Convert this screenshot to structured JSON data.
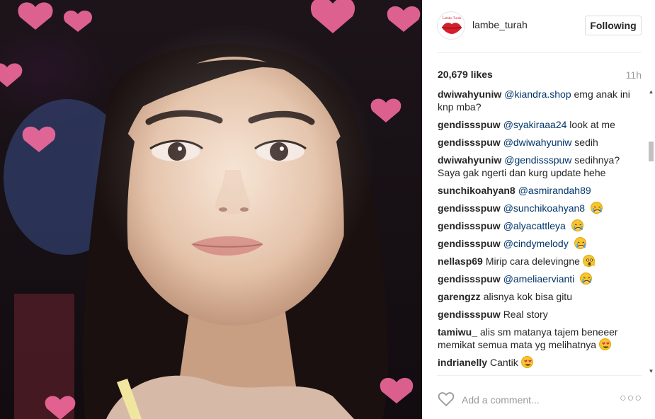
{
  "post": {
    "username": "lambe_turah",
    "follow_label": "Following",
    "likes": "20,679 likes",
    "time": "11h",
    "add_comment_placeholder": "Add a comment..."
  },
  "comments": [
    {
      "user": "dwiwahyuniw",
      "mention": "@kiandra.shop",
      "text": "emg anak ini knp mba?",
      "emoji": ""
    },
    {
      "user": "gendissspuw",
      "mention": "@syakiraaa24",
      "text": "look at me",
      "emoji": ""
    },
    {
      "user": "gendissspuw",
      "mention": "@dwiwahyuniw",
      "text": "sedih",
      "emoji": ""
    },
    {
      "user": "dwiwahyuniw",
      "mention": "@gendissspuw",
      "text": "sedihnya? Saya gak ngerti dan kurg update hehe",
      "emoji": ""
    },
    {
      "user": "sunchikoahyan8",
      "mention": "@asmirandah89",
      "text": "",
      "emoji": ""
    },
    {
      "user": "gendissspuw",
      "mention": "@sunchikoahyan8",
      "text": "",
      "emoji": "crying"
    },
    {
      "user": "gendissspuw",
      "mention": "@alyacattleya",
      "text": "",
      "emoji": "crying"
    },
    {
      "user": "gendissspuw",
      "mention": "@cindymelody",
      "text": "",
      "emoji": "crying"
    },
    {
      "user": "nellasp69",
      "mention": "",
      "text": "Mirip cara delevingne",
      "emoji": "screaming"
    },
    {
      "user": "gendissspuw",
      "mention": "@ameliaervianti",
      "text": "",
      "emoji": "crying"
    },
    {
      "user": "garengzz",
      "mention": "",
      "text": "alisnya kok bisa gitu",
      "emoji": ""
    },
    {
      "user": "gendissspuw",
      "mention": "",
      "text": "Real story",
      "emoji": ""
    },
    {
      "user": "tamiwu_",
      "mention": "",
      "text": "alis sm matanya tajem beneeer memikat semua mata yg melihatnya",
      "emoji": "heart-eyes"
    },
    {
      "user": "indrianelly",
      "mention": "",
      "text": "Cantik",
      "emoji": "heart-eyes"
    }
  ],
  "colors": {
    "mention": "#003569",
    "muted": "#999999",
    "border": "#dbdbdb"
  },
  "icons": {
    "like": "heart-outline-icon",
    "more": "more-options-icon",
    "avatar": "lips-logo"
  }
}
